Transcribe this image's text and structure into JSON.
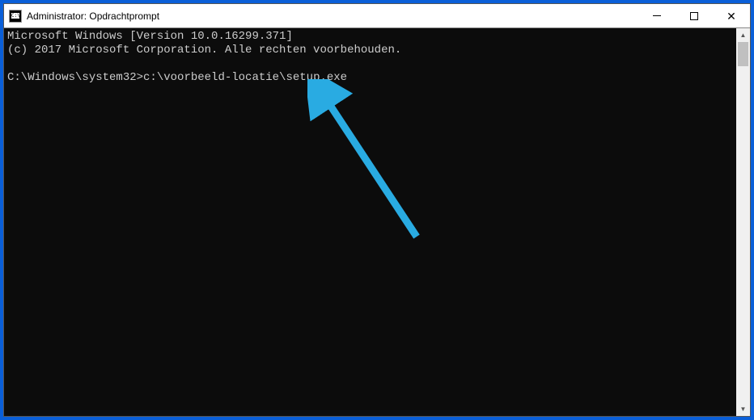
{
  "titlebar": {
    "icon_label": "C:\\",
    "title": "Administrator: Opdrachtprompt"
  },
  "terminal": {
    "line1": "Microsoft Windows [Version 10.0.16299.371]",
    "line2": "(c) 2017 Microsoft Corporation. Alle rechten voorbehouden.",
    "prompt": "C:\\Windows\\system32>",
    "command": "c:\\voorbeeld-locatie\\setup.exe"
  },
  "scrollbar": {
    "up": "▲",
    "down": "▼"
  }
}
